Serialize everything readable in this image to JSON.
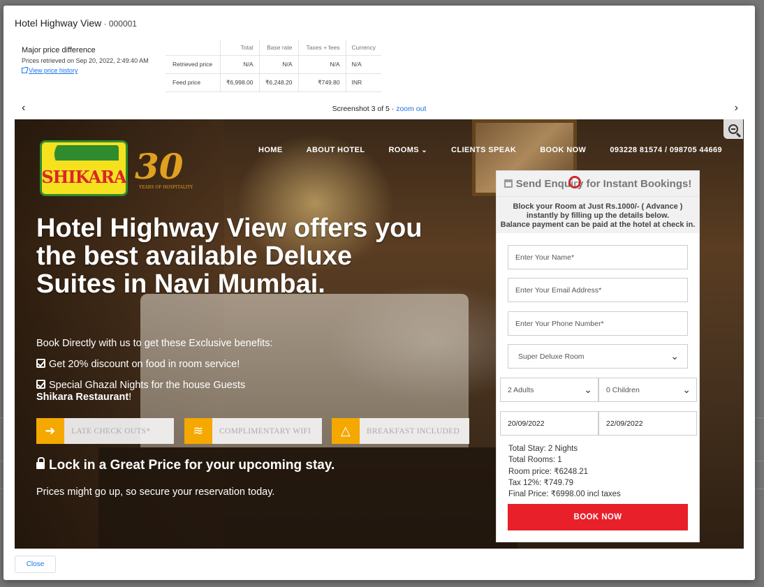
{
  "modal": {
    "title": "Hotel Highway View",
    "title_sep": " · ",
    "id": "000001",
    "price_heading": "Major price difference",
    "retrieved_text": "Prices retrieved on Sep 20, 2022, 2:49:40 AM",
    "history_link": "View price history",
    "close_label": "Close"
  },
  "price_table": {
    "headers": [
      "Total",
      "Base rate",
      "Taxes + fees",
      "Currency"
    ],
    "rows": [
      {
        "label": "Retrieved price",
        "total": "N/A",
        "base": "N/A",
        "taxes": "N/A",
        "currency": "N/A"
      },
      {
        "label": "Feed price",
        "total": "₹6,998.00",
        "base": "₹6,248.20",
        "taxes": "₹749.80",
        "currency": "INR"
      }
    ]
  },
  "screenshot_nav": {
    "caption": "Screenshot 3 of 5",
    "sep": " · ",
    "zoom_label": "zoom out",
    "prev_icon": "chevron-left-icon",
    "next_icon": "chevron-right-icon"
  },
  "site": {
    "logo_text": "SHIKARA",
    "anniv_number": "30",
    "anniv_sub": "YEARS OF HOSPITALITY",
    "nav": [
      "HOME",
      "ABOUT HOTEL",
      "ROOMS",
      "CLIENTS SPEAK",
      "BOOK NOW"
    ],
    "phone": "093228 81574 / 098705 44669",
    "hero_title": "Hotel Highway View offers you the best available Deluxe Suites in Navi Mumbai.",
    "benefits_intro": "Book Directly with us to get these Exclusive benefits:",
    "benefit_1": "Get 20% discount on food in room service!",
    "benefit_2": "Special Ghazal Nights for the house Guests",
    "benefit_2_bold": "Shikara Restaurant",
    "benefit_2_tail": "!",
    "features": [
      "LATE CHECK OUTS*",
      "COMPLIMENTARY WIFI",
      "BREAKFAST INCLUDED"
    ],
    "lock_text": "Lock in a Great Price for your upcoming stay.",
    "prices_up": "Prices might go up, so secure your reservation today."
  },
  "enquiry": {
    "title": "Send Enquiry for Instant Bookings!",
    "note_1": "Block your Room at Just Rs.1000/- ( Advance )",
    "note_2": "instantly by filling up the details below.",
    "note_3": "Balance payment can be paid at the hotel at check in.",
    "name_placeholder": "Enter Your Name*",
    "email_placeholder": "Enter Your Email Address*",
    "phone_placeholder": "Enter Your Phone Number*",
    "room_type": "Super Deluxe Room",
    "adults": "2 Adults",
    "children": "0 Children",
    "checkin": "20/09/2022",
    "checkout": "22/09/2022",
    "total_stay": "Total Stay: 2 Nights",
    "total_rooms": "Total Rooms: 1",
    "room_price": "Room price: ₹6248.21",
    "tax": "Tax 12%: ₹749.79",
    "final_price": "Final Price: ₹6998.00 incl taxes",
    "book_label": "BOOK NOW"
  },
  "colors": {
    "accent": "#1a73e8",
    "book_button": "#e8202a",
    "feature_icon": "#f4a800"
  }
}
